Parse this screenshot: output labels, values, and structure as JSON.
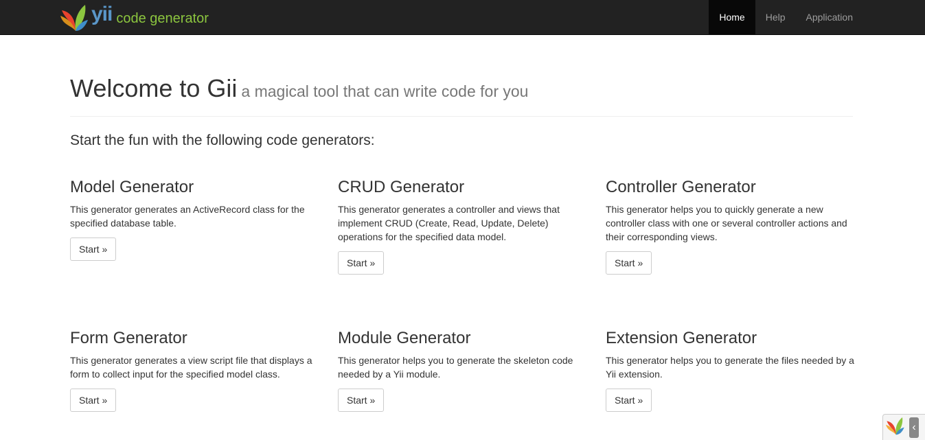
{
  "brand": {
    "word": "yii",
    "subtitle": "code generator",
    "logo_icon": "yii-leaf-logo-icon"
  },
  "nav": {
    "items": [
      {
        "label": "Home",
        "active": true
      },
      {
        "label": "Help",
        "active": false
      },
      {
        "label": "Application",
        "active": false
      }
    ]
  },
  "header": {
    "title": "Welcome to Gii",
    "subtitle": "a magical tool that can write code for you"
  },
  "lead": "Start the fun with the following code generators:",
  "generators": [
    {
      "title": "Model Generator",
      "description": "This generator generates an ActiveRecord class for the specified database table.",
      "button": "Start »"
    },
    {
      "title": "CRUD Generator",
      "description": "This generator generates a controller and views that implement CRUD (Create, Read, Update, Delete) operations for the specified data model.",
      "button": "Start »"
    },
    {
      "title": "Controller Generator",
      "description": "This generator helps you to quickly generate a new controller class with one or several controller actions and their corresponding views.",
      "button": "Start »"
    },
    {
      "title": "Form Generator",
      "description": "This generator generates a view script file that displays a form to collect input for the specified model class.",
      "button": "Start »"
    },
    {
      "title": "Module Generator",
      "description": "This generator helps you to generate the skeleton code needed by a Yii module.",
      "button": "Start »"
    },
    {
      "title": "Extension Generator",
      "description": "This generator helps you to generate the files needed by a Yii extension.",
      "button": "Start »"
    }
  ],
  "debug_toolbar": {
    "logo_icon": "yii-leaf-logo-icon",
    "toggle_icon": "chevron-left-icon"
  },
  "colors": {
    "navbar_bg": "#222222",
    "brand_blue": "#5a96c8",
    "brand_green": "#8cc63f",
    "active_nav": "#080808"
  }
}
